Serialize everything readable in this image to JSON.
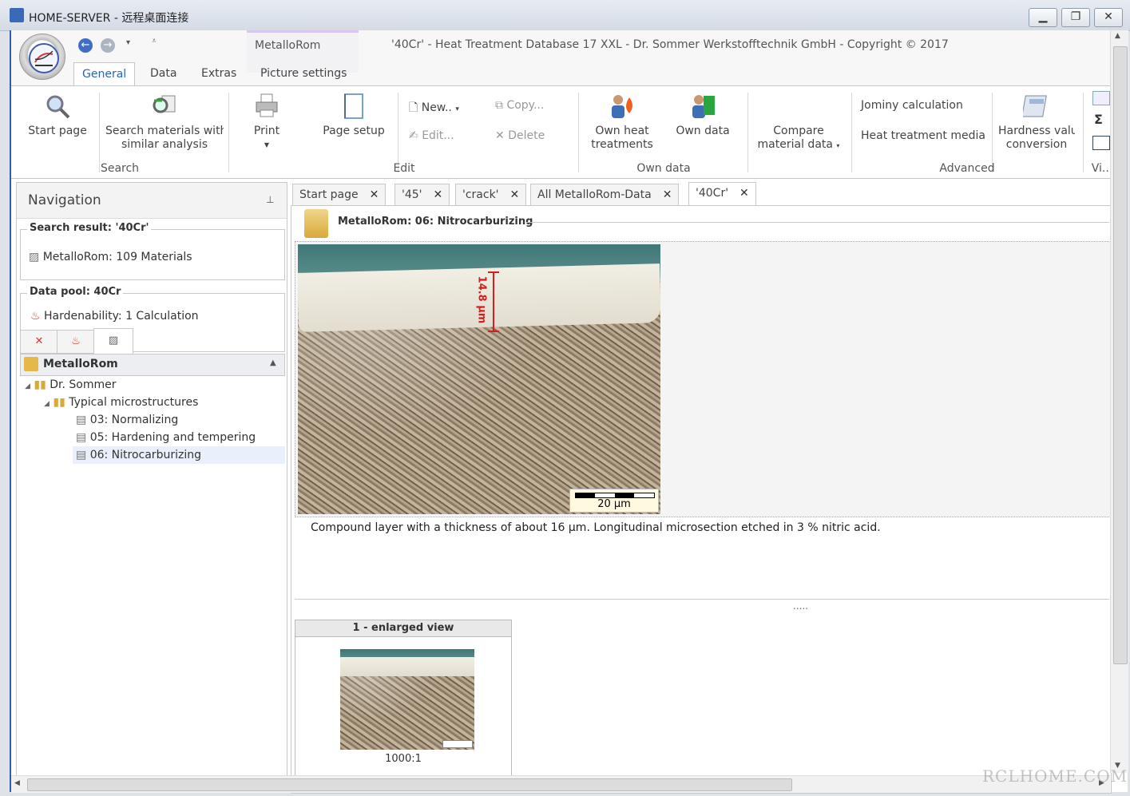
{
  "window": {
    "title": "HOME-SERVER - 远程桌面连接"
  },
  "app": {
    "title": "'40Cr' - Heat Treatment Database 17 XXL - Dr. Sommer Werkstofftechnik GmbH - Copyright © 2017",
    "context_group": "MetalloRom",
    "tabs": [
      "General",
      "Data",
      "Extras",
      "Picture settings"
    ],
    "active_tab": "General"
  },
  "ribbon": {
    "search": {
      "group": "Search",
      "start_page": "Start page",
      "similar_line1": "Search materials with",
      "similar_line2": "similar analysis"
    },
    "edit": {
      "group": "Edit",
      "print": "Print",
      "page_setup": "Page setup",
      "new": "New..",
      "copy": "Copy...",
      "edit": "Edit...",
      "delete": "Delete"
    },
    "own_data": {
      "group": "Own data",
      "own_heat_line1": "Own heat",
      "own_heat_line2": "treatments",
      "own_data": "Own data",
      "compare_line1": "Compare",
      "compare_line2": "material data"
    },
    "advanced": {
      "group": "Advanced",
      "jominy": "Jominy calculation",
      "media": "Heat treatment media",
      "hardness_line1": "Hardness value",
      "hardness_line2": "conversion"
    },
    "view": {
      "group": "Vi..."
    }
  },
  "navigation": {
    "title": "Navigation",
    "search_result_legend": "Search result: '40Cr'",
    "search_result_item": "MetalloRom: 109 Materials",
    "data_pool_legend": "Data pool: 40Cr",
    "data_pool_item": "Hardenability: 1 Calculation",
    "panel_header": "MetalloRom",
    "tree": [
      "Dr. Sommer",
      "Typical microstructures",
      "03: Normalizing",
      "05: Hardening and tempering",
      "06: Nitrocarburizing"
    ]
  },
  "doc_tabs": [
    "Start page",
    "'45'",
    "'crack'",
    "All MetalloRom-Data",
    "'40Cr'"
  ],
  "content": {
    "header": "MetalloRom: 06: Nitrocarburizing",
    "measure_label": "14.8 µm",
    "scale_label": "20 µm",
    "caption": "Compound layer with a thickness of about 16 µm. Longitudinal microsection etched in 3 % nitric acid.",
    "splitter": ".....",
    "thumb_title": "1 - enlarged view",
    "thumb_mag": "1000:1"
  },
  "watermark": "RCLHOME.COM",
  "colors": {
    "accent": "#2a63b8",
    "measure": "#d02020",
    "frame": "#2f5fa8"
  }
}
